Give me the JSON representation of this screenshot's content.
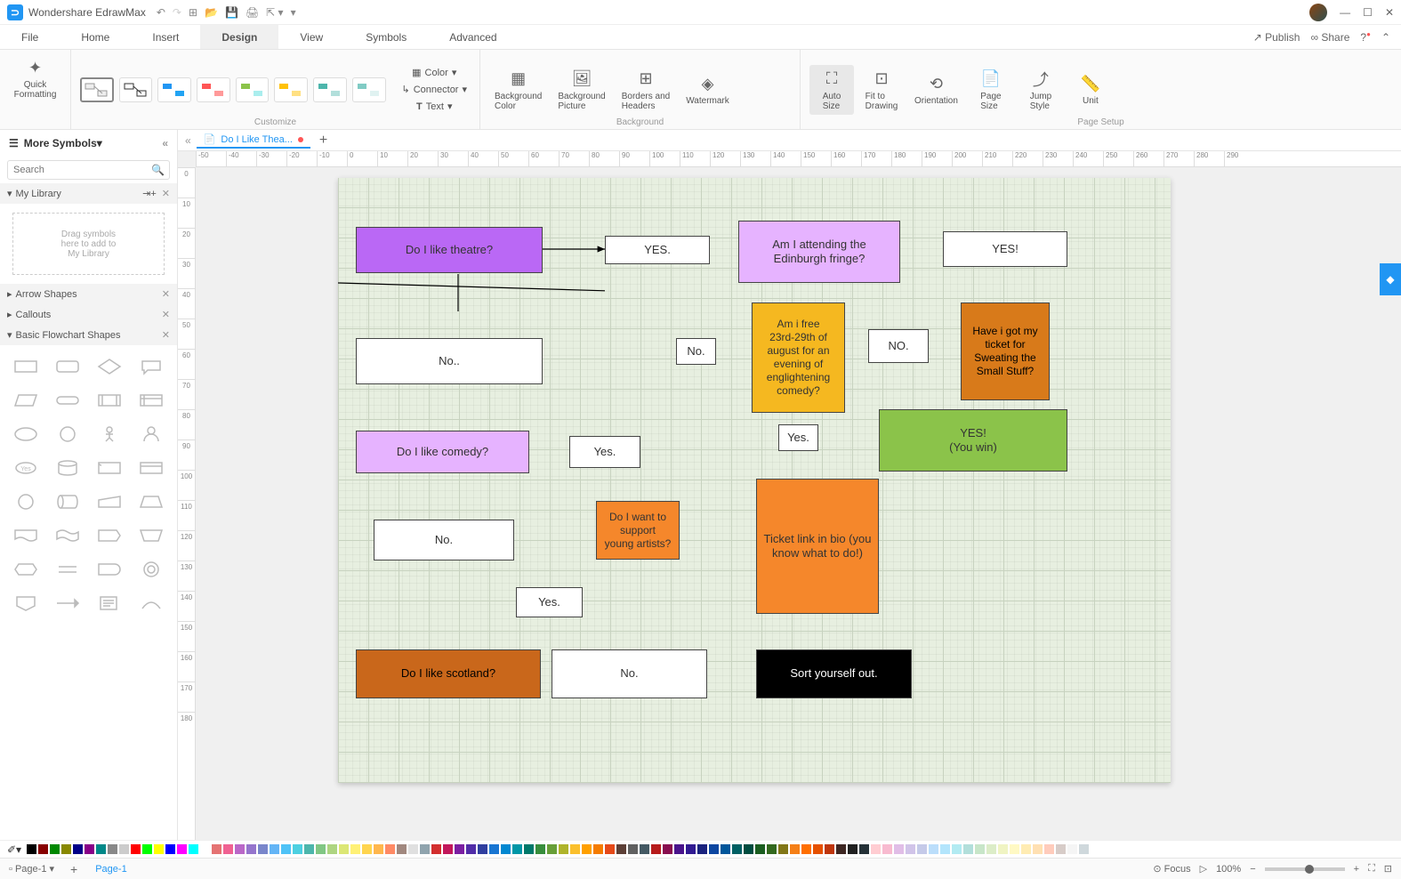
{
  "app": {
    "title": "Wondershare EdrawMax"
  },
  "menu": {
    "items": [
      "File",
      "Home",
      "Insert",
      "Design",
      "View",
      "Symbols",
      "Advanced"
    ],
    "active": "Design",
    "publish": "Publish",
    "share": "Share"
  },
  "ribbon": {
    "quick_formatting": "Quick\nFormatting",
    "customize_label": "Customize",
    "color": "Color",
    "connector": "Connector",
    "text": "Text",
    "background_color": "Background\nColor",
    "background_picture": "Background\nPicture",
    "borders_headers": "Borders and\nHeaders",
    "watermark": "Watermark",
    "background_label": "Background",
    "auto_size": "Auto\nSize",
    "fit_drawing": "Fit to\nDrawing",
    "orientation": "Orientation",
    "page_size": "Page\nSize",
    "jump_style": "Jump\nStyle",
    "unit": "Unit",
    "pagesetup_label": "Page Setup"
  },
  "sidebar": {
    "more_symbols": "More Symbols",
    "search_placeholder": "Search",
    "my_library": "My Library",
    "dropzone": "Drag symbols\nhere to add to\nMy Library",
    "arrow_shapes": "Arrow Shapes",
    "callouts": "Callouts",
    "basic_flowchart": "Basic Flowchart Shapes"
  },
  "doc": {
    "tab_name": "Do I Like Thea..."
  },
  "nodes": {
    "theatre": "Do I like theatre?",
    "yes1": "YES.",
    "edinburgh": "Am I attending the\nEdinburgh fringe?",
    "yes2": "YES!",
    "ticket_sweat": "Have i got my\nticket for\nSweating the\nSmall Stuff?",
    "no1": "NO.",
    "free": "Am i free\n23rd-29th of\naugust for an\nevening of\nenglightening\ncomedy?",
    "no2": "No..",
    "no_small": "No.",
    "comedy": "Do I like comedy?",
    "yes3": "Yes.",
    "yes4": "Yes.",
    "win": "YES!\n(You win)",
    "no3": "No.",
    "support": "Do I want to\nsupport\nyoung artists?",
    "ticket_bio": "Ticket link in bio (you\nknow what to do!)",
    "yes5": "Yes.",
    "scotland": "Do I like scotland?",
    "no4": "No.",
    "sort": "Sort yourself out."
  },
  "ruler_h": [
    "-50",
    "-40",
    "-30",
    "-20",
    "-10",
    "0",
    "10",
    "20",
    "30",
    "40",
    "50",
    "60",
    "70",
    "80",
    "90",
    "100",
    "110",
    "120",
    "130",
    "140",
    "150",
    "160",
    "170",
    "180",
    "190",
    "200",
    "210",
    "220",
    "230",
    "240",
    "250",
    "260",
    "270",
    "280",
    "290"
  ],
  "ruler_v": [
    "0",
    "10",
    "20",
    "30",
    "40",
    "50",
    "60",
    "70",
    "80",
    "90",
    "100",
    "110",
    "120",
    "130",
    "140",
    "150",
    "160",
    "170",
    "180"
  ],
  "status": {
    "page_btn": "Page-1",
    "page_link": "Page-1",
    "focus": "Focus",
    "zoom": "100%"
  },
  "colors": [
    "#000",
    "#800",
    "#080",
    "#880",
    "#008",
    "#808",
    "#088",
    "#888",
    "#ccc",
    "#f00",
    "#0f0",
    "#ff0",
    "#00f",
    "#f0f",
    "#0ff",
    "#fff",
    "#e57373",
    "#f06292",
    "#ba68c8",
    "#9575cd",
    "#7986cb",
    "#64b5f6",
    "#4fc3f7",
    "#4dd0e1",
    "#4db6ac",
    "#81c784",
    "#aed581",
    "#dce775",
    "#fff176",
    "#ffd54f",
    "#ffb74d",
    "#ff8a65",
    "#a1887f",
    "#e0e0e0",
    "#90a4ae",
    "#d32f2f",
    "#c2185b",
    "#7b1fa2",
    "#512da8",
    "#303f9f",
    "#1976d2",
    "#0288d1",
    "#0097a7",
    "#00796b",
    "#388e3c",
    "#689f38",
    "#afb42b",
    "#fbc02d",
    "#ffa000",
    "#f57c00",
    "#e64a19",
    "#5d4037",
    "#616161",
    "#455a64",
    "#b71c1c",
    "#880e4f",
    "#4a148c",
    "#311b92",
    "#1a237e",
    "#0d47a1",
    "#01579b",
    "#006064",
    "#004d40",
    "#1b5e20",
    "#33691e",
    "#827717",
    "#f57f17",
    "#ff6f00",
    "#e65100",
    "#bf360c",
    "#3e2723",
    "#212121",
    "#263238",
    "#ffcdd2",
    "#f8bbd0",
    "#e1bee7",
    "#d1c4e9",
    "#c5cae9",
    "#bbdefb",
    "#b3e5fc",
    "#b2ebf2",
    "#b2dfdb",
    "#c8e6c9",
    "#dcedc8",
    "#f0f4c3",
    "#fff9c4",
    "#ffecb3",
    "#ffe0b2",
    "#ffccbc",
    "#d7ccc8",
    "#f5f5f5",
    "#cfd8dc"
  ]
}
